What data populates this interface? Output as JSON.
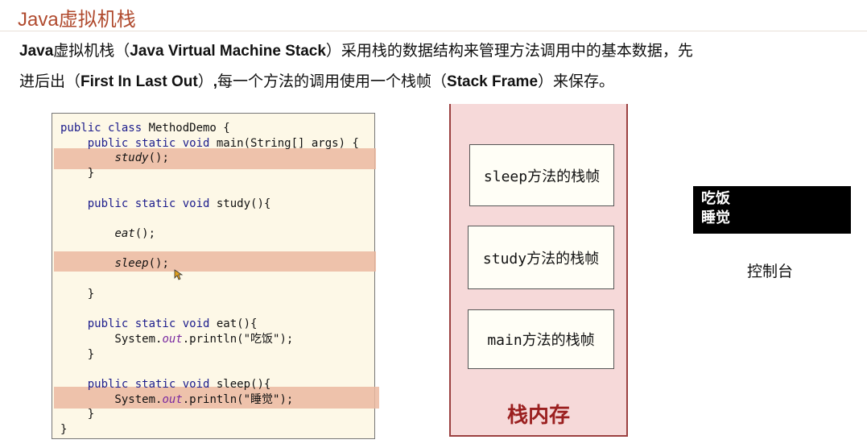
{
  "title": "Java虚拟机栈",
  "paragraph": {
    "line1": [
      {
        "text": "Java",
        "bold": true
      },
      {
        "text": "虚拟机栈（",
        "bold": false
      },
      {
        "text": "Java Virtual Machine Stack",
        "bold": true
      },
      {
        "text": "）采用栈的数据结构来管理方法调用中的基本数据，先",
        "bold": false
      }
    ],
    "line2": [
      {
        "text": "进后出（",
        "bold": false
      },
      {
        "text": "First In Last Out",
        "bold": true
      },
      {
        "text": "）",
        "bold": false
      },
      {
        "text": ",",
        "bold": true
      },
      {
        "text": "每一个方法的调用使用一个栈帧（",
        "bold": false
      },
      {
        "text": "Stack Frame",
        "bold": true
      },
      {
        "text": "）来保存。",
        "bold": false
      }
    ]
  },
  "code": {
    "lines": [
      [
        {
          "t": "public class ",
          "c": "kw"
        },
        {
          "t": "MethodDemo {",
          "c": ""
        }
      ],
      [
        {
          "t": "    public static void ",
          "c": "kw"
        },
        {
          "t": "main(String[] args) {",
          "c": ""
        }
      ],
      [
        {
          "t": "        ",
          "c": ""
        },
        {
          "t": "study",
          "c": "it"
        },
        {
          "t": "();",
          "c": ""
        }
      ],
      [
        {
          "t": "    }",
          "c": ""
        }
      ],
      [
        {
          "t": "",
          "c": ""
        }
      ],
      [
        {
          "t": "    public static void ",
          "c": "kw"
        },
        {
          "t": "study(){",
          "c": ""
        }
      ],
      [
        {
          "t": "",
          "c": ""
        }
      ],
      [
        {
          "t": "        ",
          "c": ""
        },
        {
          "t": "eat",
          "c": "it"
        },
        {
          "t": "();",
          "c": ""
        }
      ],
      [
        {
          "t": "",
          "c": ""
        }
      ],
      [
        {
          "t": "        ",
          "c": ""
        },
        {
          "t": "sleep",
          "c": "it"
        },
        {
          "t": "();",
          "c": ""
        }
      ],
      [
        {
          "t": "",
          "c": ""
        }
      ],
      [
        {
          "t": "    }",
          "c": ""
        }
      ],
      [
        {
          "t": "",
          "c": ""
        }
      ],
      [
        {
          "t": "    public static void ",
          "c": "kw"
        },
        {
          "t": "eat(){",
          "c": ""
        }
      ],
      [
        {
          "t": "        System.",
          "c": ""
        },
        {
          "t": "out",
          "c": "field"
        },
        {
          "t": ".println(\"吃饭\");",
          "c": ""
        }
      ],
      [
        {
          "t": "    }",
          "c": ""
        }
      ],
      [
        {
          "t": "",
          "c": ""
        }
      ],
      [
        {
          "t": "    public static void ",
          "c": "kw"
        },
        {
          "t": "sleep(){",
          "c": ""
        }
      ],
      [
        {
          "t": "        System.",
          "c": ""
        },
        {
          "t": "out",
          "c": "field"
        },
        {
          "t": ".println(\"睡觉\");",
          "c": ""
        }
      ],
      [
        {
          "t": "    }",
          "c": ""
        }
      ],
      [
        {
          "t": "}",
          "c": ""
        }
      ]
    ]
  },
  "stack": {
    "frames": [
      "sleep方法的栈帧",
      "study方法的栈帧",
      "main方法的栈帧"
    ],
    "label": "栈内存"
  },
  "console": {
    "lines": [
      "吃饭",
      "睡觉"
    ],
    "label": "控制台"
  },
  "colors": {
    "title": "#b04a2e",
    "highlight": "#ebb8a0",
    "code_bg": "#fdf8e7",
    "stack_bg": "#f6d9d9",
    "stack_label": "#9b2020"
  },
  "icons": [
    "mouse-cursor-icon"
  ]
}
